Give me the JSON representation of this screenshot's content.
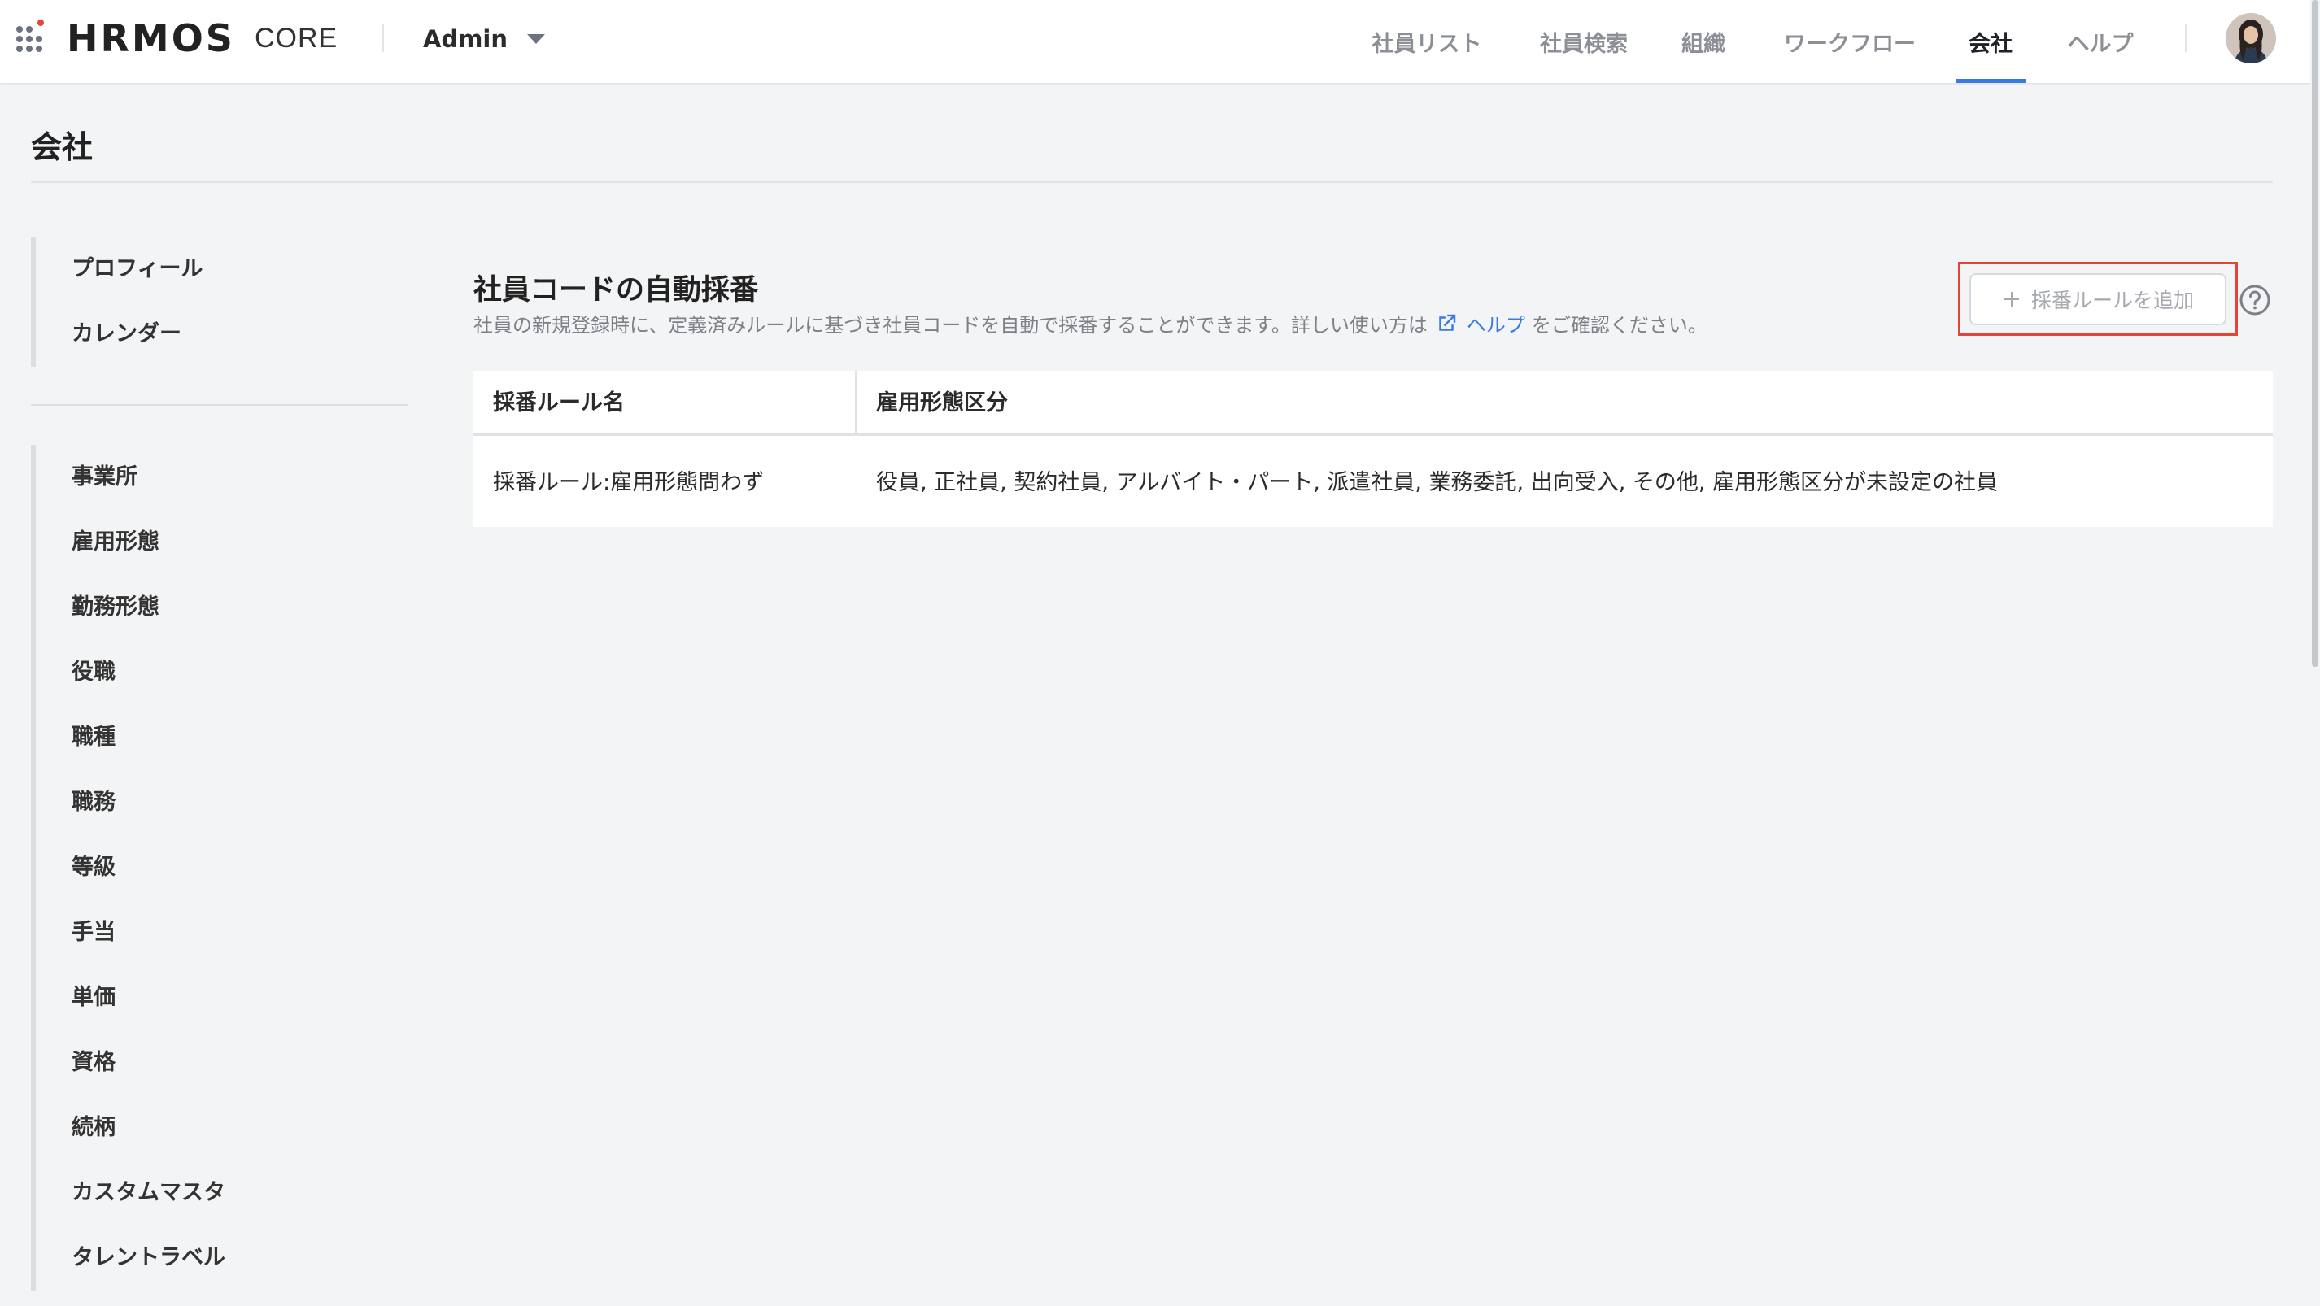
{
  "header": {
    "logo_main": "HRMOS",
    "logo_sub": "CORE",
    "role": "Admin",
    "nav": [
      {
        "label": "社員リスト",
        "active": false
      },
      {
        "label": "社員検索",
        "active": false
      },
      {
        "label": "組織",
        "active": false
      },
      {
        "label": "ワークフロー",
        "active": false
      },
      {
        "label": "会社",
        "active": true
      },
      {
        "label": "ヘルプ",
        "active": false
      }
    ],
    "accent_color": "#3a7be0"
  },
  "page": {
    "title": "会社"
  },
  "sidebar": {
    "group1": [
      {
        "label": "プロフィール"
      },
      {
        "label": "カレンダー"
      }
    ],
    "group2": [
      {
        "label": "事業所"
      },
      {
        "label": "雇用形態"
      },
      {
        "label": "勤務形態"
      },
      {
        "label": "役職"
      },
      {
        "label": "職種"
      },
      {
        "label": "職務"
      },
      {
        "label": "等級"
      },
      {
        "label": "手当"
      },
      {
        "label": "単価"
      },
      {
        "label": "資格"
      },
      {
        "label": "続柄"
      },
      {
        "label": "カスタムマスタ"
      },
      {
        "label": "タレントラベル"
      }
    ]
  },
  "section": {
    "title": "社員コードの自動採番",
    "desc_before": "社員の新規登録時に、定義済みルールに基づき社員コードを自動で採番することができます。詳しい使い方は",
    "help_link": "ヘルプ",
    "desc_after": "をご確認ください。",
    "add_button": "採番ルールを追加",
    "highlight_color": "#e2463a"
  },
  "table": {
    "headers": [
      "採番ルール名",
      "雇用形態区分"
    ],
    "rows": [
      [
        "採番ルール:雇用形態問わず",
        "役員, 正社員, 契約社員, アルバイト・パート, 派遣社員, 業務委託, 出向受入, その他, 雇用形態区分が未設定の社員"
      ]
    ]
  },
  "icons": [
    "app-grid-icon",
    "chevron-down-icon",
    "external-link-icon",
    "plus-icon",
    "question-circle-icon",
    "avatar"
  ]
}
